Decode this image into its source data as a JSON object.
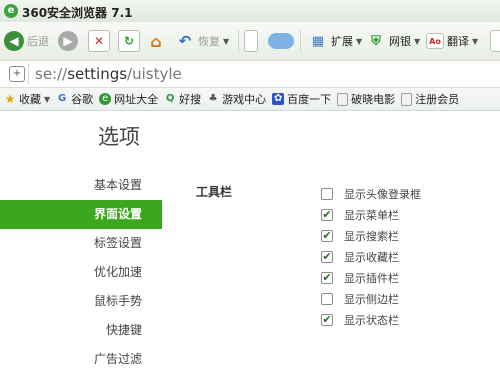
{
  "window": {
    "title": "360安全浏览器 7.1"
  },
  "toolbar": {
    "back_label": "后退",
    "restore_label": "恢复",
    "extensions_label": "扩展",
    "bank_label": "网银",
    "translate_label": "翻译"
  },
  "address": {
    "scheme": "se://",
    "path": "settings",
    "rest": "/uistyle"
  },
  "favorites": {
    "label": "收藏",
    "items": [
      "谷歌",
      "网址大全",
      "好搜",
      "游戏中心",
      "百度一下",
      "破晓电影",
      "注册会员"
    ]
  },
  "settings": {
    "title": "选项",
    "nav": [
      "基本设置",
      "界面设置",
      "标签设置",
      "优化加速",
      "鼠标手势",
      "快捷键",
      "广告过滤"
    ],
    "active_index": 1,
    "section_label": "工具栏",
    "options": [
      {
        "label": "显示头像登录框",
        "checked": false
      },
      {
        "label": "显示菜单栏",
        "checked": true
      },
      {
        "label": "显示搜索栏",
        "checked": true
      },
      {
        "label": "显示收藏栏",
        "checked": true
      },
      {
        "label": "显示插件栏",
        "checked": true
      },
      {
        "label": "显示侧边栏",
        "checked": false
      },
      {
        "label": "显示状态栏",
        "checked": true
      }
    ]
  },
  "colors": {
    "accent": "#3ca71e",
    "logo": "#3aa43a"
  }
}
